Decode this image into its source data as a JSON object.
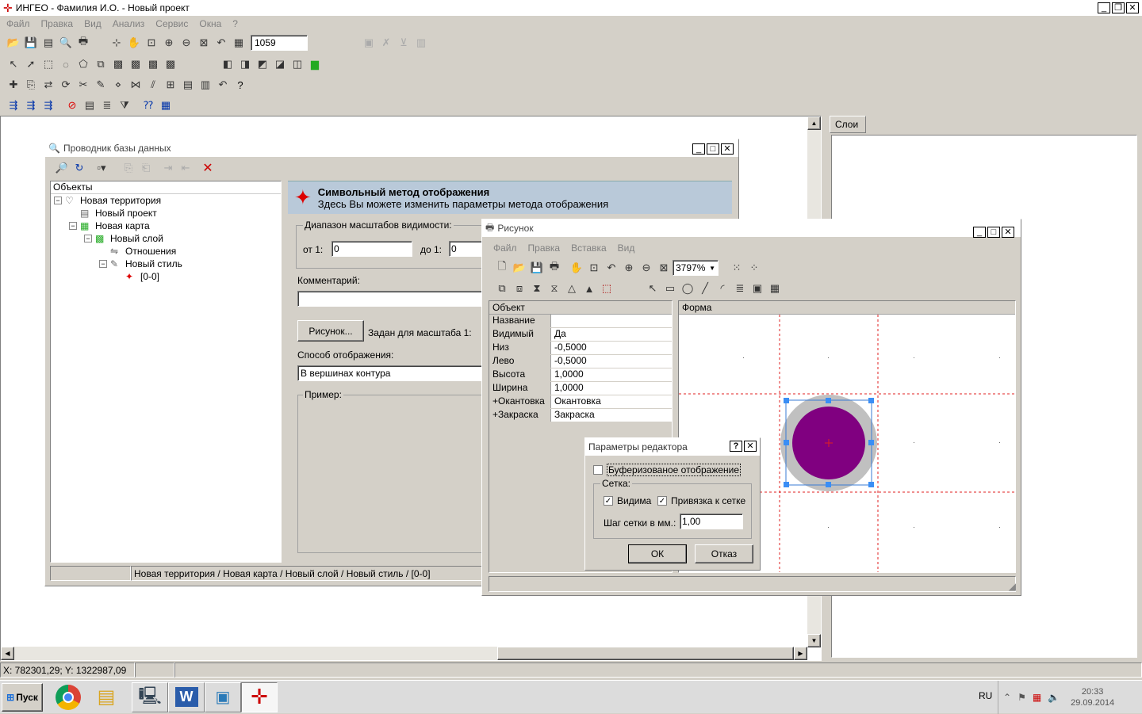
{
  "app": {
    "title": "ИНГЕО - Фамилия И.О. - Новый проект",
    "menu": [
      "Файл",
      "Правка",
      "Вид",
      "Анализ",
      "Сервис",
      "Окна",
      "?"
    ],
    "scale_value": "1059"
  },
  "explorer": {
    "title": "Проводник базы данных",
    "tree_header": "Объекты",
    "tree": [
      {
        "label": "Новая территория",
        "level": 0
      },
      {
        "label": "Новый проект",
        "level": 1
      },
      {
        "label": "Новая карта",
        "level": 1
      },
      {
        "label": "Новый слой",
        "level": 2
      },
      {
        "label": "Отношения",
        "level": 3
      },
      {
        "label": "Новый стиль",
        "level": 3
      },
      {
        "label": "[0-0]",
        "level": 4
      }
    ],
    "header_title": "Символьный метод отображения",
    "header_subtitle": "Здесь Вы можете изменить параметры метода отображения",
    "range_legend": "Диапазон масштабов видимости:",
    "from_label": "от 1:",
    "from_value": "0",
    "to_label": "до 1:",
    "to_value": "0",
    "comment_label": "Комментарий:",
    "picture_button": "Рисунок...",
    "scale_note": "Задан для масштаба 1:",
    "method_label": "Способ отображения:",
    "method_value": "В вершинах контура",
    "example_legend": "Пример:",
    "status_path": "Новая территория / Новая карта / Новый слой / Новый стиль / [0-0]"
  },
  "picture": {
    "title": "Рисунок",
    "menu": [
      "Файл",
      "Правка",
      "Вставка",
      "Вид"
    ],
    "zoom": "3797%",
    "object_header": "Объект",
    "form_header": "Форма",
    "properties": [
      {
        "k": "Название",
        "v": ""
      },
      {
        "k": "Видимый",
        "v": "Да"
      },
      {
        "k": "Низ",
        "v": "-0,5000"
      },
      {
        "k": "Лево",
        "v": "-0,5000"
      },
      {
        "k": "Высота",
        "v": "1,0000"
      },
      {
        "k": "Ширина",
        "v": "1,0000"
      },
      {
        "k": "+Окантовка",
        "v": "Окантовка"
      },
      {
        "k": "+Закраска",
        "v": "Закраска"
      }
    ],
    "fill_color": "#800080",
    "ring_color": "#c0c0c0"
  },
  "editor_params": {
    "title": "Параметры редактора",
    "buffered_label": "Буферизованое отображение",
    "grid_legend": "Сетка:",
    "visible_label": "Видима",
    "snap_label": "Привязка к сетке",
    "step_label": "Шаг сетки в мм.:",
    "step_value": "1,00",
    "ok": "ОК",
    "cancel": "Отказ"
  },
  "layers": {
    "tab": "Слои"
  },
  "status": {
    "coords": "X: 782301,29; Y: 1322987,09"
  },
  "taskbar": {
    "start": "Пуск",
    "lang": "RU",
    "time": "20:33",
    "date": "29.09.2014"
  }
}
